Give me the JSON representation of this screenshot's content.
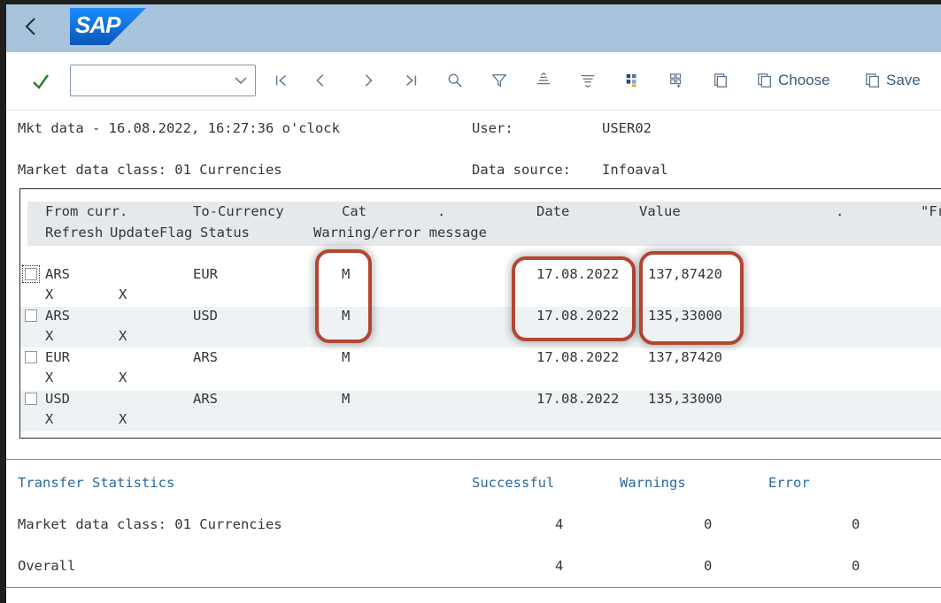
{
  "shell": {
    "back_label": "<",
    "logo_text": "SAP"
  },
  "toolbar": {
    "command_placeholder": "",
    "icons": [
      "check-icon",
      "first-page-icon",
      "previous-page-icon",
      "next-page-icon",
      "last-page-icon",
      "find-icon",
      "filter-icon",
      "sort-ascending-icon",
      "sort-descending-icon",
      "layout-icon",
      "sum-icon",
      "details-icon"
    ],
    "choose_label": "Choose",
    "save_label": "Save"
  },
  "header_info": {
    "title": "Mkt data - 16.08.2022, 16:27:36 o'clock",
    "user_label": "User:",
    "user_value": "USER02",
    "class_label": "Market data class: 01 Currencies",
    "source_label": "Data source:",
    "source_value": "Infoaval"
  },
  "grid": {
    "columns_row1": {
      "from": "From curr.",
      "to": "To-Currency",
      "cat": "Cat",
      "dot1": ".",
      "date": "Date",
      "value": "Value",
      "dot2": ".",
      "fr": "\"Fr"
    },
    "columns_row2": {
      "refresh": "Refresh",
      "updateflag": "UpdateFlag",
      "status": "Status",
      "message": "Warning/error message"
    },
    "rows": [
      {
        "from": "ARS",
        "to": "EUR",
        "cat": "M",
        "date": "17.08.2022",
        "value": "137,87420",
        "refresh": "X",
        "update": "X"
      },
      {
        "from": "ARS",
        "to": "USD",
        "cat": "M",
        "date": "17.08.2022",
        "value": "135,33000",
        "refresh": "X",
        "update": "X"
      },
      {
        "from": "EUR",
        "to": "ARS",
        "cat": "M",
        "date": "17.08.2022",
        "value": "137,87420",
        "refresh": "X",
        "update": "X"
      },
      {
        "from": "USD",
        "to": "ARS",
        "cat": "M",
        "date": "17.08.2022",
        "value": "135,33000",
        "refresh": "X",
        "update": "X"
      }
    ]
  },
  "stats": {
    "title": "Transfer Statistics",
    "col_successful": "Successful",
    "col_warnings": "Warnings",
    "col_error": "Error",
    "rows": [
      {
        "label": "Market data class: 01 Currencies",
        "successful": "4",
        "warnings": "0",
        "error": "0"
      },
      {
        "label": "Overall",
        "successful": "4",
        "warnings": "0",
        "error": "0"
      }
    ]
  },
  "colors": {
    "shell_bg": "#a8c4dc",
    "highlight": "#b5452f",
    "link_blue": "#2a6aa0",
    "check_green": "#2b7d2b",
    "sap_blue": "#0a6ed1"
  }
}
